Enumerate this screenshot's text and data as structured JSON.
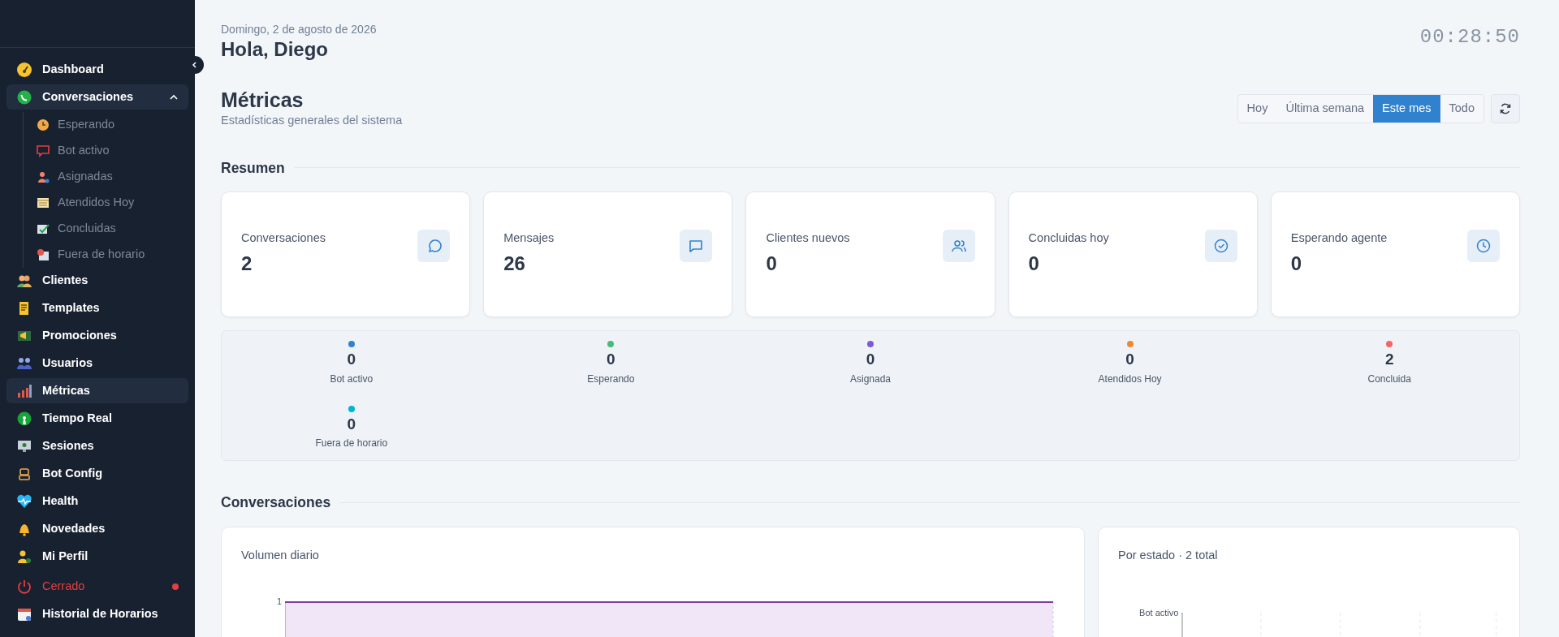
{
  "sidebar": {
    "items": [
      {
        "kind": "link",
        "label": "Dashboard",
        "selected": false
      },
      {
        "kind": "group",
        "label": "Conversaciones",
        "selected": false,
        "expanded": true,
        "children": [
          {
            "label": "Esperando"
          },
          {
            "label": "Bot activo"
          },
          {
            "label": "Asignadas"
          },
          {
            "label": "Atendidos Hoy"
          },
          {
            "label": "Concluidas"
          },
          {
            "label": "Fuera de horario"
          }
        ]
      },
      {
        "kind": "link",
        "label": "Clientes",
        "selected": false
      },
      {
        "kind": "link",
        "label": "Templates",
        "selected": false
      },
      {
        "kind": "link",
        "label": "Promociones",
        "selected": false
      },
      {
        "kind": "link",
        "label": "Usuarios",
        "selected": false
      },
      {
        "kind": "link",
        "label": "Métricas",
        "selected": true
      },
      {
        "kind": "link",
        "label": "Tiempo Real",
        "selected": false
      },
      {
        "kind": "link",
        "label": "Sesiones",
        "selected": false
      },
      {
        "kind": "link",
        "label": "Bot Config",
        "selected": false
      },
      {
        "kind": "link",
        "label": "Health",
        "selected": false
      },
      {
        "kind": "link",
        "label": "Novedades",
        "selected": false
      },
      {
        "kind": "link",
        "label": "Mi Perfil",
        "selected": false
      },
      {
        "kind": "status",
        "label": "Cerrado",
        "color": "#e53e3e"
      },
      {
        "kind": "link",
        "label": "Historial de Horarios",
        "selected": false
      }
    ]
  },
  "header": {
    "date": "Domingo, 2 de agosto de 2026",
    "greeting": "Hola, Diego",
    "clock": "00:28:50"
  },
  "page": {
    "title": "Métricas",
    "subtitle": "Estadísticas generales del sistema"
  },
  "range_buttons": [
    {
      "label": "Hoy",
      "selected": false
    },
    {
      "label": "Última semana",
      "selected": false
    },
    {
      "label": "Este mes",
      "selected": true
    },
    {
      "label": "Todo",
      "selected": false
    }
  ],
  "summary": {
    "heading": "Resumen",
    "cards": [
      {
        "label": "Conversaciones",
        "value": "2"
      },
      {
        "label": "Mensajes",
        "value": "26"
      },
      {
        "label": "Clientes nuevos",
        "value": "0"
      },
      {
        "label": "Concluidas hoy",
        "value": "0"
      },
      {
        "label": "Esperando agente",
        "value": "0"
      }
    ]
  },
  "status_breakdown": [
    {
      "label": "Bot activo",
      "value": "0",
      "color": "#3182ce"
    },
    {
      "label": "Esperando",
      "value": "0",
      "color": "#48bb78"
    },
    {
      "label": "Asignada",
      "value": "0",
      "color": "#805ad5"
    },
    {
      "label": "Atendidos Hoy",
      "value": "0",
      "color": "#ed8936"
    },
    {
      "label": "Concluida",
      "value": "2",
      "color": "#f56565"
    },
    {
      "label": "Fuera de horario",
      "value": "0",
      "color": "#00b5d8"
    }
  ],
  "conversations": {
    "heading": "Conversaciones",
    "charts": [
      {
        "kind": "area",
        "title": "Volumen diario",
        "tick_labels": [
          "1"
        ]
      },
      {
        "kind": "hbar",
        "title": "Por estado · 2 total",
        "tick_labels": [
          "Bot activo"
        ]
      }
    ]
  }
}
